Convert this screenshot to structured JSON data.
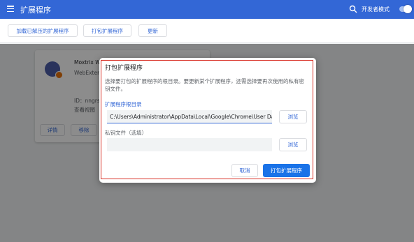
{
  "header": {
    "title": "扩展程序",
    "dev_mode_label": "开发者模式",
    "dev_mode_on": true
  },
  "toolbar": {
    "load_unpacked": "加载已解压的扩展程序",
    "pack": "打包扩展程序",
    "update": "更新"
  },
  "extension_card": {
    "name": "Moxtrix W",
    "description": "WebExten",
    "id_text": "ID：nngrs",
    "view_text": "查看视图",
    "details_button": "详情",
    "remove_button": "移除"
  },
  "dialog": {
    "title": "打包扩展程序",
    "description": "选择要打包的扩展程序的根目录。要更新某个扩展程序，还需选择要再次使用的私有密钥文件。",
    "root_label": "扩展程序根目录",
    "root_value": "C:\\Users\\Administrator\\AppData\\Local\\Google\\Chrome\\User Data",
    "key_label": "私钥文件（选填）",
    "key_value": "",
    "browse_label": "浏览",
    "cancel_label": "取消",
    "confirm_label": "打包扩展程序"
  },
  "colors": {
    "header_bg": "#3367d6",
    "accent": "#1a73e8",
    "highlight_frame": "#d93025"
  }
}
